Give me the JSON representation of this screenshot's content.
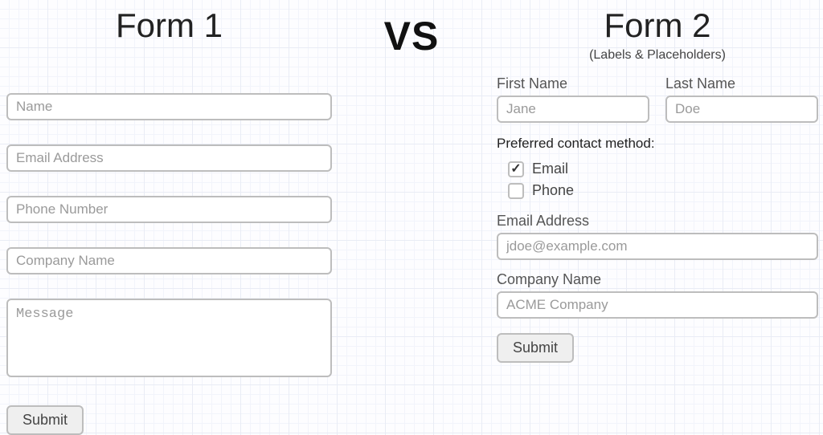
{
  "vs_label": "VS",
  "form1": {
    "title": "Form 1",
    "fields": {
      "name_placeholder": "Name",
      "email_placeholder": "Email Address",
      "phone_placeholder": "Phone Number",
      "company_placeholder": "Company Name",
      "message_placeholder": "Message"
    },
    "submit_label": "Submit"
  },
  "form2": {
    "title": "Form 2",
    "subtitle": "(Labels & Placeholders)",
    "first_name": {
      "label": "First Name",
      "placeholder": "Jane"
    },
    "last_name": {
      "label": "Last Name",
      "placeholder": "Doe"
    },
    "contact_method": {
      "group_label": "Preferred contact method:",
      "options": [
        {
          "label": "Email",
          "checked": true
        },
        {
          "label": "Phone",
          "checked": false
        }
      ]
    },
    "email": {
      "label": "Email Address",
      "placeholder": "jdoe@example.com"
    },
    "company": {
      "label": "Company Name",
      "placeholder": "ACME Company"
    },
    "submit_label": "Submit"
  }
}
